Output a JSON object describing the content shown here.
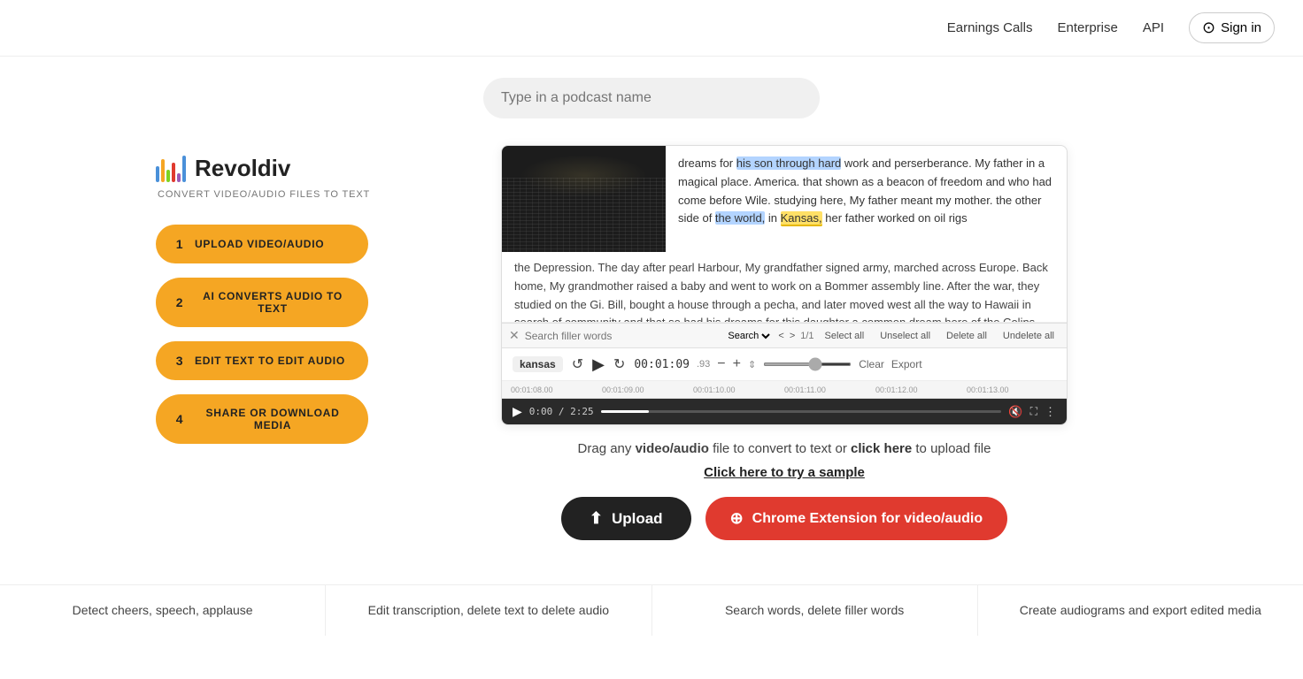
{
  "nav": {
    "earnings_calls": "Earnings Calls",
    "enterprise": "Enterprise",
    "api": "API",
    "sign_in": "Sign in"
  },
  "search": {
    "placeholder": "Type in a podcast name"
  },
  "logo": {
    "title": "Revoldiv"
  },
  "tagline": "Convert video/audio files to text",
  "steps": [
    {
      "num": "1",
      "label": "Upload video/audio"
    },
    {
      "num": "2",
      "label": "AI converts audio to text"
    },
    {
      "num": "3",
      "label": "Edit text to edit audio"
    },
    {
      "num": "4",
      "label": "Share or download media"
    }
  ],
  "demo": {
    "transcript_text": "dreams for his son through hard work and perserberance. My father in a magical place. America. that shown as a beacon of freedom and who had come before Wile. studying here, My father meant my mother. the other side of the world, in Kansas, her father worked on oil rigs the Depression. The day after pearl Harbour, My grandfather signed army, marched across Europe. Back home, My grandmother raised a baby and went to work on a Bommer assembly line. After the war, they studied on the Gi. Bill, bought a house through a pecha, and later moved west all the way to Hawaii in search of community and that so had his dreams for his daughter a common dream here of the Colins. My parents shared not only an improbable love, they shared an abiding faith in the",
    "search_placeholder": "Search filler words",
    "search_count": "1/1",
    "word_label": "kansas",
    "time": "00:01:09",
    "confidence": ".93",
    "vp_time": "0:00 / 2:25",
    "timeline_markers": [
      "00:01:08.00",
      "00:01:09.00",
      "00:01:10.00",
      "00:01:11.00",
      "00:01:12.00",
      "00:01:13.00"
    ],
    "clear": "Clear",
    "export": "Export",
    "select_all": "Select all",
    "unselect_all": "Unselect all",
    "delete_all": "Delete all",
    "undelete_all": "Undelete all"
  },
  "drag_area": {
    "text_before": "Drag any ",
    "bold": "video/audio",
    "text_middle": " file to convert to text or ",
    "link": "click here",
    "text_after": " to upload file"
  },
  "sample_link": "Click here to try a sample",
  "buttons": {
    "upload": "Upload",
    "chrome_extension": "Chrome Extension for video/audio"
  },
  "features": [
    "Detect cheers, speech, applause",
    "Edit transcription, delete text to delete audio",
    "Search words, delete filler words",
    "Create audiograms and export edited media"
  ]
}
